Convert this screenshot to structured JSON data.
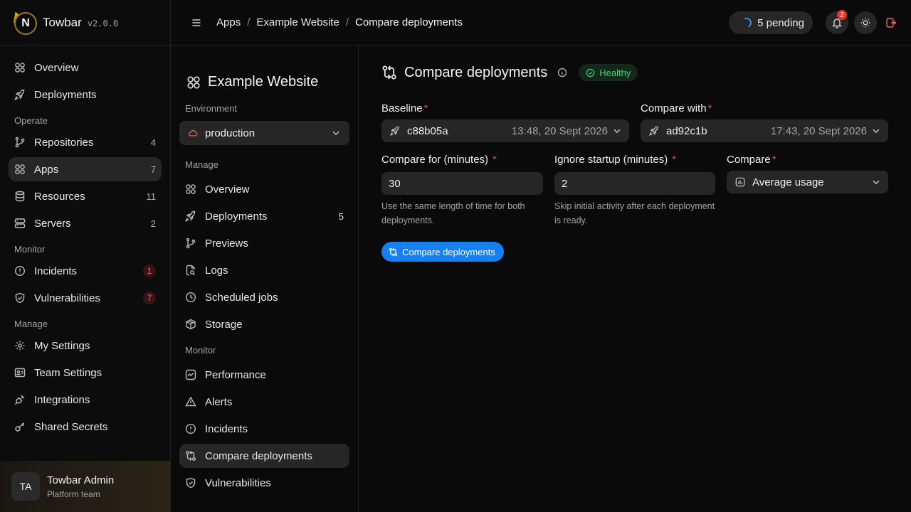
{
  "brand": {
    "name": "Towbar",
    "version": "v2.0.0",
    "logo_letter": "N"
  },
  "sidebar": {
    "top_items": [
      {
        "label": "Overview",
        "icon": "overview-icon"
      },
      {
        "label": "Deployments",
        "icon": "rocket-icon"
      }
    ],
    "operate_heading": "Operate",
    "operate_items": [
      {
        "label": "Repositories",
        "count": "4",
        "icon": "branch-icon"
      },
      {
        "label": "Apps",
        "count": "7",
        "icon": "apps-icon",
        "active": true
      },
      {
        "label": "Resources",
        "count": "11",
        "icon": "database-icon"
      },
      {
        "label": "Servers",
        "count": "2",
        "icon": "server-icon"
      }
    ],
    "monitor_heading": "Monitor",
    "monitor_items": [
      {
        "label": "Incidents",
        "count": "1",
        "icon": "alert-circle-icon"
      },
      {
        "label": "Vulnerabilities",
        "count": "7",
        "icon": "shield-icon"
      }
    ],
    "manage_heading": "Manage",
    "manage_items": [
      {
        "label": "My Settings",
        "icon": "gear-icon"
      },
      {
        "label": "Team Settings",
        "icon": "team-icon"
      },
      {
        "label": "Integrations",
        "icon": "plug-icon"
      },
      {
        "label": "Shared Secrets",
        "icon": "key-icon"
      }
    ]
  },
  "user": {
    "initials": "TA",
    "name": "Towbar Admin",
    "team": "Platform team"
  },
  "topbar": {
    "breadcrumbs": [
      "Apps",
      "Example Website",
      "Compare deployments"
    ],
    "separator": "/",
    "pending_label": "5 pending",
    "notification_count": "2"
  },
  "app": {
    "title": "Example Website",
    "environment_heading": "Environment",
    "environment": "production",
    "manage_heading": "Manage",
    "manage_items": [
      {
        "label": "Overview",
        "icon": "overview-icon"
      },
      {
        "label": "Deployments",
        "count": "5",
        "icon": "rocket-icon"
      },
      {
        "label": "Previews",
        "icon": "branch-icon"
      },
      {
        "label": "Logs",
        "icon": "file-search-icon"
      },
      {
        "label": "Scheduled jobs",
        "icon": "clock-icon"
      },
      {
        "label": "Storage",
        "icon": "box-icon"
      }
    ],
    "monitor_heading": "Monitor",
    "monitor_items": [
      {
        "label": "Performance",
        "icon": "activity-icon"
      },
      {
        "label": "Alerts",
        "icon": "warning-icon"
      },
      {
        "label": "Incidents",
        "icon": "alert-circle-icon"
      },
      {
        "label": "Compare deployments",
        "icon": "compare-icon",
        "active": true
      },
      {
        "label": "Vulnerabilities",
        "icon": "shield-icon"
      }
    ]
  },
  "main": {
    "title": "Compare deployments",
    "status": "Healthy",
    "baseline": {
      "label": "Baseline",
      "value": "c88b05a",
      "time": "13:48, 20 Sept 2026"
    },
    "compare_with": {
      "label": "Compare with",
      "value": "ad92c1b",
      "time": "17:43, 20 Sept 2026"
    },
    "compare_for": {
      "label": "Compare for (minutes)",
      "value": "30",
      "hint": "Use the same length of time for both deployments."
    },
    "ignore_startup": {
      "label": "Ignore startup (minutes)",
      "value": "2",
      "hint": "Skip initial activity after each deployment is ready."
    },
    "compare": {
      "label": "Compare",
      "value": "Average usage"
    },
    "submit_label": "Compare deployments"
  },
  "colors": {
    "accent": "#1480f2",
    "healthy": "#4ccb73",
    "danger": "#e84848"
  }
}
